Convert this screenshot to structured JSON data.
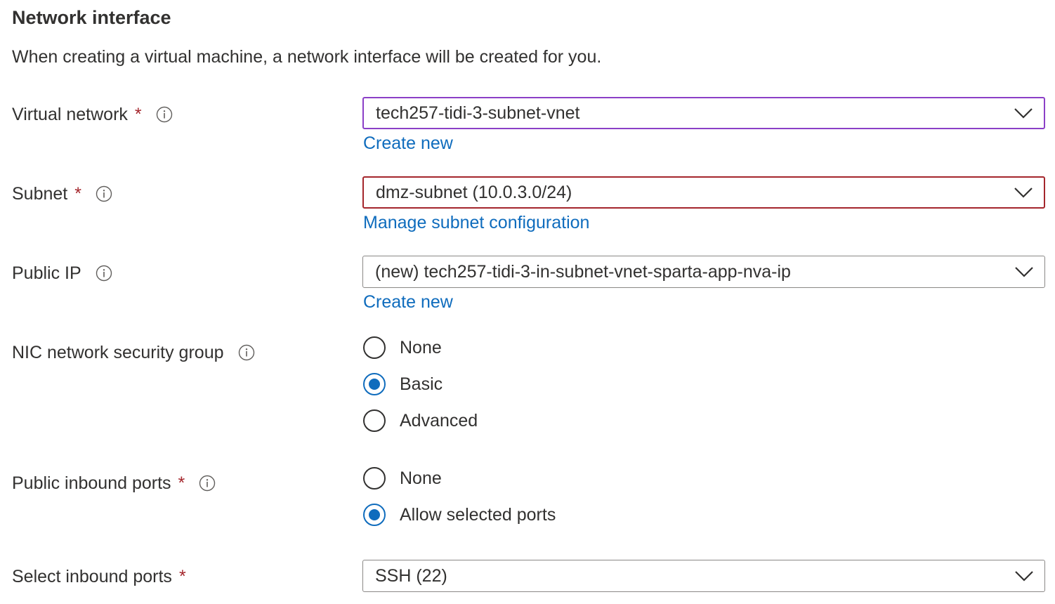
{
  "section": {
    "title": "Network interface",
    "description": "When creating a virtual machine, a network interface will be created for you."
  },
  "required_marker": "*",
  "fields": {
    "virtual_network": {
      "label": "Virtual network",
      "value": "tech257-tidi-3-subnet-vnet",
      "link": "Create new"
    },
    "subnet": {
      "label": "Subnet",
      "value": "dmz-subnet (10.0.3.0/24)",
      "link": "Manage subnet configuration"
    },
    "public_ip": {
      "label": "Public IP",
      "value": "(new) tech257-tidi-3-in-subnet-vnet-sparta-app-nva-ip",
      "link": "Create new"
    },
    "nic_nsg": {
      "label": "NIC network security group",
      "options": [
        "None",
        "Basic",
        "Advanced"
      ],
      "selected": "Basic"
    },
    "public_inbound_ports": {
      "label": "Public inbound ports",
      "options": [
        "None",
        "Allow selected ports"
      ],
      "selected": "Allow selected ports"
    },
    "select_inbound_ports": {
      "label": "Select inbound ports",
      "value": "SSH (22)"
    }
  },
  "colors": {
    "link": "#0f6cbd",
    "required": "#a4262c",
    "focus_border": "#8b3fc7",
    "error_border": "#a4262c",
    "radio_selected": "#0f6cbd"
  },
  "icons": {
    "info": "info-circle-icon",
    "dropdown": "chevron-down-icon"
  }
}
